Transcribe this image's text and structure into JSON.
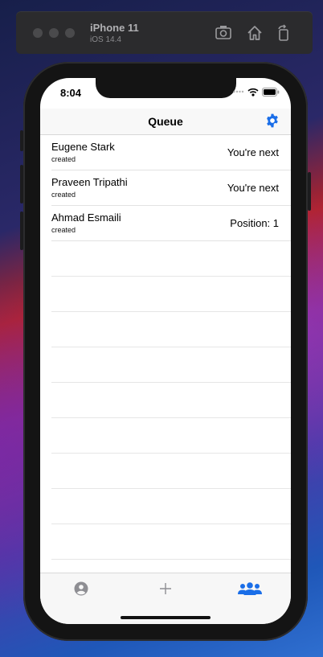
{
  "simulator": {
    "device_name": "iPhone 11",
    "os_version": "iOS 14.4"
  },
  "status_bar": {
    "time": "8:04"
  },
  "nav": {
    "title": "Queue"
  },
  "queue": [
    {
      "name": "Eugene Stark",
      "subtitle": "created",
      "status": "You're next"
    },
    {
      "name": "Praveen Tripathi",
      "subtitle": "created",
      "status": "You're next"
    },
    {
      "name": "Ahmad Esmaili",
      "subtitle": "created",
      "status": "Position: 1"
    }
  ],
  "tab_bar": {
    "tabs": [
      {
        "icon": "person-icon",
        "active": false
      },
      {
        "icon": "plus-icon",
        "active": false
      },
      {
        "icon": "group-icon",
        "active": true
      }
    ]
  },
  "colors": {
    "accent": "#1a6ee8",
    "inactive_icon": "#8e8e93"
  }
}
